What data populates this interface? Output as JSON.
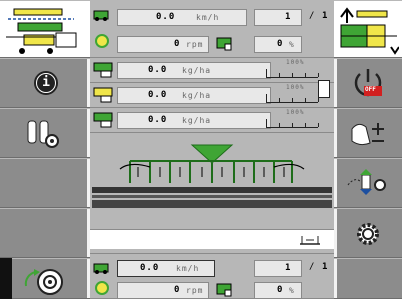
{
  "top_panel": {
    "speed": {
      "value": "0.0",
      "unit": "km/h"
    },
    "gear": {
      "value": "1",
      "slash": "/",
      "total": "1"
    },
    "rpm": {
      "value": "0",
      "unit": "rpm"
    },
    "percent": {
      "value": "0",
      "unit": "%"
    }
  },
  "bins": [
    {
      "rate": "0.0",
      "unit": "kg/ha",
      "scale_label": "100%",
      "fill_fraction": 0.0
    },
    {
      "rate": "0.0",
      "unit": "kg/ha",
      "scale_label": "100%",
      "fill_fraction": 0.0
    },
    {
      "rate": "0.0",
      "unit": "kg/ha",
      "scale_label": "100%",
      "fill_fraction": 0.0
    }
  ],
  "bottom_panel": {
    "speed": {
      "value": "0.0",
      "unit": "km/h"
    },
    "gear": {
      "value": "1",
      "slash": "/",
      "total": "1"
    },
    "rpm": {
      "value": "0",
      "unit": "rpm"
    },
    "percent": {
      "value": "0",
      "unit": "%"
    }
  },
  "colors": {
    "accent_green": "#3fa535",
    "selected_yellow": "#f0e64a",
    "panel_gray": "#b7b7b7",
    "sidebar_gray": "#8c8c8c",
    "off_red": "#d22020"
  },
  "icons": {
    "left": [
      "machine-overview-icon",
      "info-icon",
      "tires-settings-icon",
      "empty",
      "empty",
      "wheel-settings-icon"
    ],
    "right": [
      "machine-selection-icon",
      "power-off-icon",
      "bag-adjust-icon",
      "transfer-icon",
      "settings-gear-icon",
      "empty"
    ]
  },
  "labels": {
    "off": "OFF"
  }
}
